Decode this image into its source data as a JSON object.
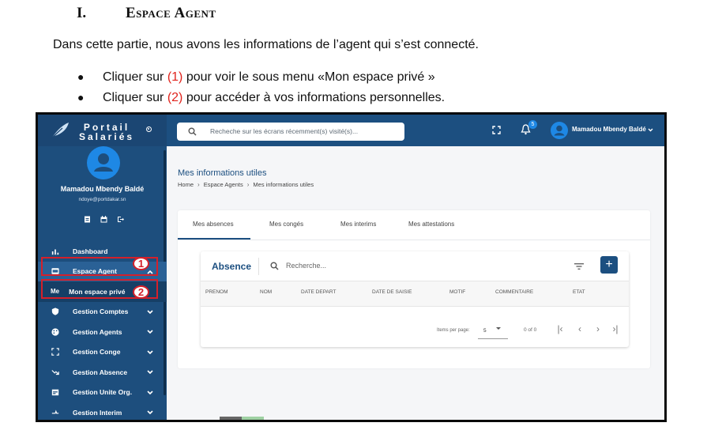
{
  "doc": {
    "heading_num": "I.",
    "heading_title": "Espace Agent",
    "intro": "Dans cette partie, nous avons les informations de l’agent qui s’est connecté.",
    "bullets": [
      {
        "prefix": "Cliquer sur ",
        "marker": "(1)",
        "suffix": " pour  voir le sous menu «Mon espace privé »"
      },
      {
        "prefix": "Cliquer sur ",
        "marker": "(2)",
        "suffix": " pour accéder à vos informations personnelles."
      }
    ],
    "marker_color": "#e0231c"
  },
  "app": {
    "brand_line1": "Portail",
    "brand_line2": "Salariés",
    "profile_name": "Mamadou Mbendy Baldé",
    "profile_email": "ndoye@portdakar.sn",
    "menu": [
      {
        "label": "Dashboard",
        "icon": "bar-chart-icon"
      },
      {
        "label": "Espace Agent",
        "icon": "id-card-icon",
        "expanded": true
      },
      {
        "label": "Mon espace privé",
        "prefix": "Me"
      },
      {
        "label": "Gestion Comptes",
        "icon": "shield-icon"
      },
      {
        "label": "Gestion Agents",
        "icon": "palette-icon"
      },
      {
        "label": "Gestion Conge",
        "icon": "expand-icon"
      },
      {
        "label": "Gestion Absence",
        "icon": "trend-down-icon"
      },
      {
        "label": "Gestion Unite Org.",
        "icon": "calendar-icon"
      },
      {
        "label": "Gestion Interim",
        "icon": "swap-icon"
      }
    ],
    "annotation_1": "1",
    "annotation_2": "2",
    "search_placeholder": "Recheche sur les écrans récemment(s) visité(s)...",
    "notification_count": "5",
    "user_name": "Mamadou Mbendy Baldé",
    "page_title": "Mes informations utiles",
    "breadcrumb": [
      "Home",
      "Espace Agents",
      "Mes informations utiles"
    ],
    "tabs": [
      "Mes absences",
      "Mes congés",
      "Mes interims",
      "Mes attestations"
    ],
    "table": {
      "title": "Absence",
      "search_placeholder": "Recherche...",
      "columns": [
        "PRENOM",
        "NOM",
        "DATE DEPART",
        "DATE DE SAISIE",
        "MOTIF",
        "COMMENTAIRE",
        "ETAT"
      ],
      "items_per_page_label": "Items per page:",
      "items_per_page": "5",
      "range": "0 of 0"
    },
    "colors": {
      "primary": "#1c4f80",
      "sidebar": "#1d4e7d",
      "accent": "#1e88e5",
      "annotation": "#d4202a"
    }
  }
}
